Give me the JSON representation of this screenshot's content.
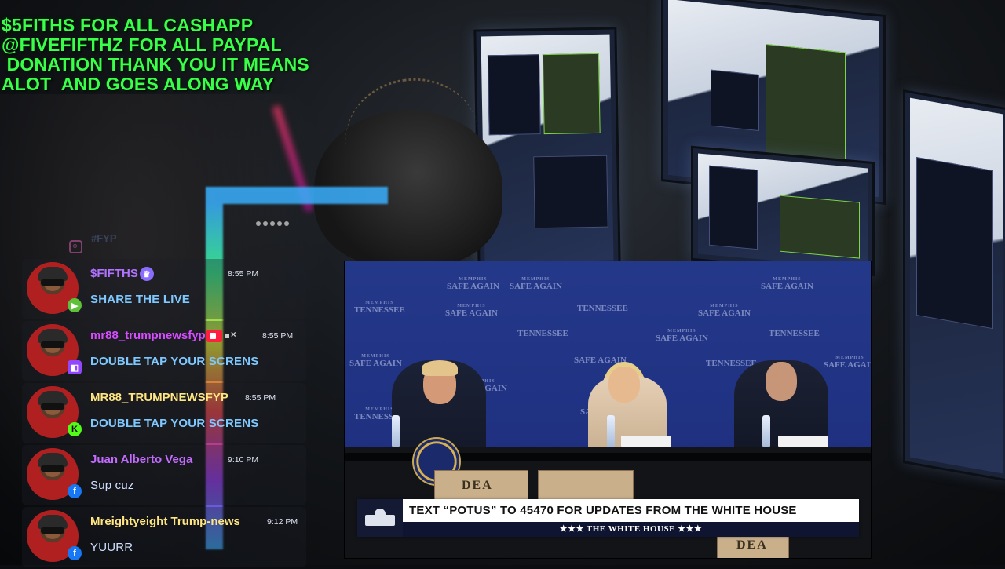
{
  "overlay": {
    "donation_lines": [
      "$5FITHS FOR ALL CASHAPP",
      "@FIVEFIFTHZ FOR ALL PAYPAL",
      " DONATION THANK YOU IT MEANS",
      "ALOT  AND GOES ALONG WAY"
    ],
    "faint_tag": "#FYP"
  },
  "chat": {
    "messages": [
      {
        "username": "$FIFTHS",
        "time": "8:55 PM",
        "text": "SHARE THE LIVE",
        "platform": "rumble"
      },
      {
        "username": "mr88_trumpnewsfyp",
        "time": "8:55 PM",
        "text": "DOUBLE TAP YOUR SCRENS",
        "platform": "twitch"
      },
      {
        "username": "MR88_TRUMPNEWSFYP",
        "time": "8:55 PM",
        "text": "DOUBLE TAP YOUR SCRENS",
        "platform": "kick"
      },
      {
        "username": "Juan Alberto Vega",
        "time": "9:10 PM",
        "text": "Sup cuz",
        "platform": "facebook"
      },
      {
        "username": "Mreightyeight Trump-news",
        "time": "9:12 PM",
        "text": "YUURR",
        "platform": "facebook"
      }
    ]
  },
  "video": {
    "backdrop_text": "SAFE AGAIN",
    "backdrop_small": "MEMPHIS",
    "backdrop_alt": "TENNESSEE",
    "box_label": "DEA",
    "banner": {
      "main": "TEXT “POTUS” TO 45470 FOR UPDATES FROM THE WHITE HOUSE",
      "sub": "★★★  THE WHITE HOUSE  ★★★"
    }
  }
}
